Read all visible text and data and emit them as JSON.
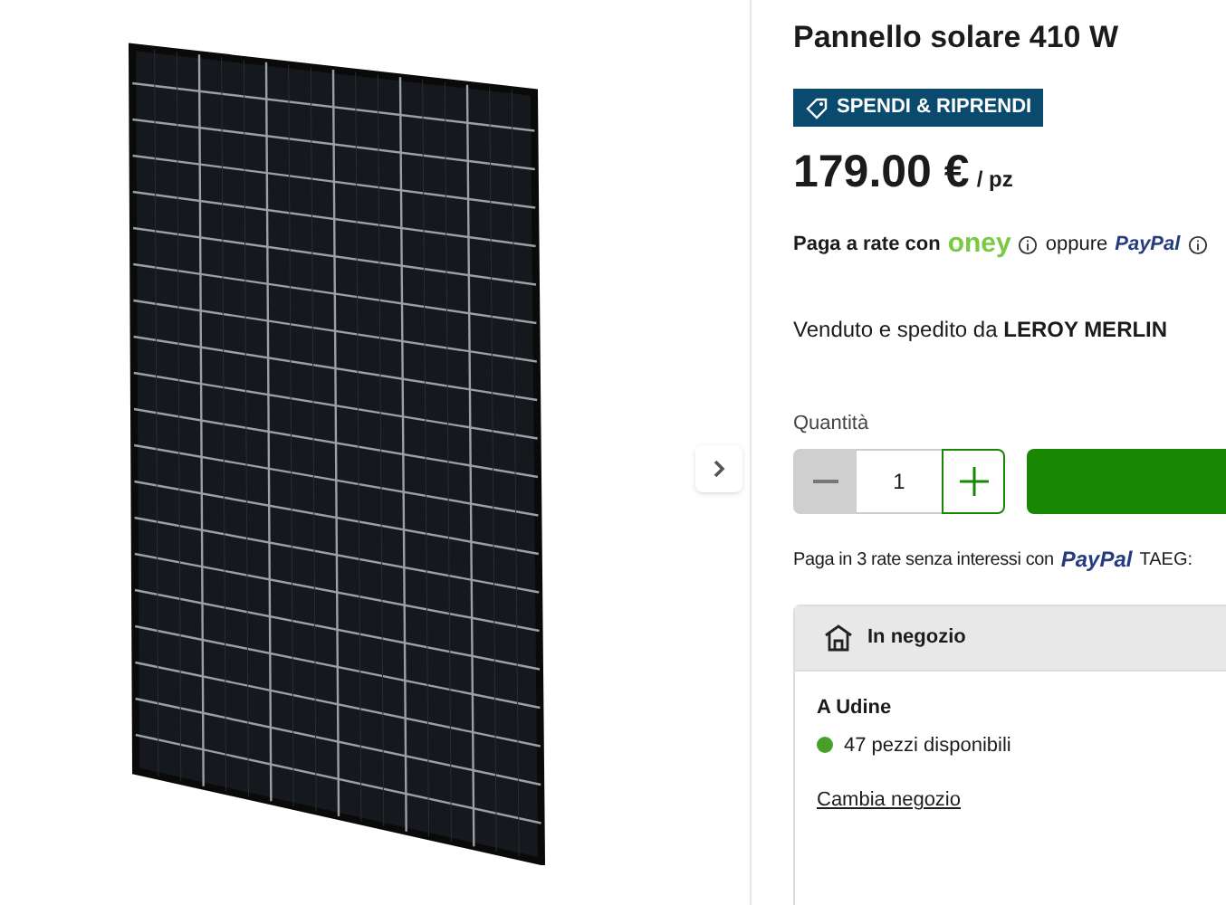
{
  "product": {
    "title": "Pannello solare 410 W",
    "badge": "SPENDI & RIPRENDI",
    "price": "179.00 €",
    "unit": "/ pz"
  },
  "installments": {
    "prefix": "Paga a rate con",
    "oney": "oney",
    "or": "oppure",
    "paypal": "PayPal"
  },
  "seller": {
    "text": "Venduto e spedito da **LEROY MERLIN**"
  },
  "quantity": {
    "label": "Quantità",
    "value": "1",
    "minus_disabled": true
  },
  "paypal_line": {
    "text": "Paga in 3 rate senza interessi con",
    "paypal": "PayPal",
    "taeg": "TAEG:"
  },
  "store": {
    "title": "In negozio",
    "city": "A Udine",
    "availability": {
      "text": "47 pezzi disponibili",
      "color": "#46a02a"
    },
    "link": "Cambia negozio"
  }
}
